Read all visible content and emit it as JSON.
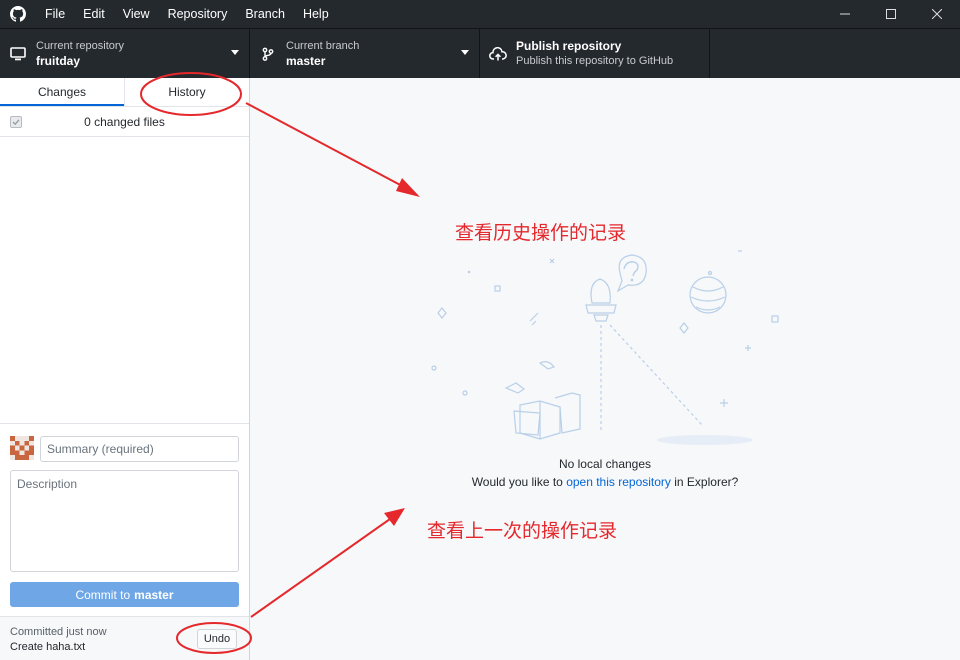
{
  "menu": [
    "File",
    "Edit",
    "View",
    "Repository",
    "Branch",
    "Help"
  ],
  "toolbar": {
    "repo_label": "Current repository",
    "repo_name": "fruitday",
    "branch_label": "Current branch",
    "branch_name": "master",
    "publish_title": "Publish repository",
    "publish_sub": "Publish this repository to GitHub"
  },
  "tabs": {
    "changes": "Changes",
    "history": "History"
  },
  "changes": {
    "count_label": "0 changed files"
  },
  "commit": {
    "summary_placeholder": "Summary (required)",
    "description_placeholder": "Description",
    "button_prefix": "Commit to",
    "button_branch": "master"
  },
  "last_commit": {
    "when": "Committed just now",
    "title": "Create haha.txt",
    "undo": "Undo"
  },
  "main": {
    "no_changes": "No local changes",
    "prompt_before": "Would you like to ",
    "prompt_link": "open this repository",
    "prompt_after": " in Explorer?"
  },
  "annotations": {
    "history_note": "查看历史操作的记录",
    "undo_note": "查看上一次的操作记录",
    "color": "#e5282c"
  }
}
